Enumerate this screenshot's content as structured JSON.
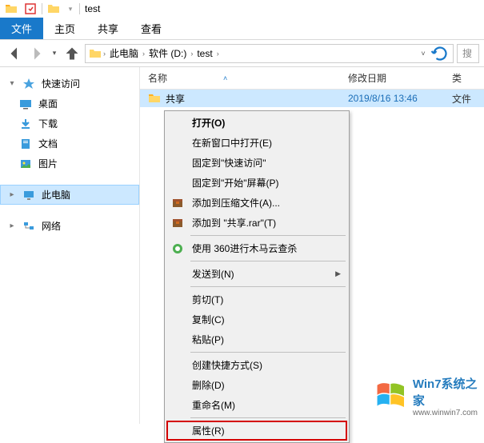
{
  "title_bar": {
    "title": "test"
  },
  "ribbon": {
    "file": "文件",
    "tabs": [
      "主页",
      "共享",
      "查看"
    ]
  },
  "breadcrumbs": [
    "此电脑",
    "软件 (D:)",
    "test"
  ],
  "search_placeholder": "搜",
  "sidebar": {
    "quick_access": {
      "label": "快速访问",
      "items": [
        "桌面",
        "下载",
        "文档",
        "图片"
      ]
    },
    "this_pc": "此电脑",
    "network": "网络"
  },
  "columns": {
    "name": "名称",
    "date": "修改日期",
    "type": "类"
  },
  "files": [
    {
      "name": "共享",
      "date": "2019/8/16 13:46",
      "type": "文件"
    }
  ],
  "context_menu": {
    "open": "打开(O)",
    "new_window": "在新窗口中打开(E)",
    "pin_quick": "固定到\"快速访问\"",
    "pin_start": "固定到\"开始\"屏幕(P)",
    "add_archive": "添加到压缩文件(A)...",
    "add_rar": "添加到 \"共享.rar\"(T)",
    "scan_360": "使用 360进行木马云查杀",
    "send_to": "发送到(N)",
    "cut": "剪切(T)",
    "copy": "复制(C)",
    "paste": "粘贴(P)",
    "shortcut": "创建快捷方式(S)",
    "delete": "删除(D)",
    "rename": "重命名(M)",
    "properties": "属性(R)"
  },
  "watermark": {
    "main": "Win7系统之家",
    "sub": "www.winwin7.com"
  }
}
